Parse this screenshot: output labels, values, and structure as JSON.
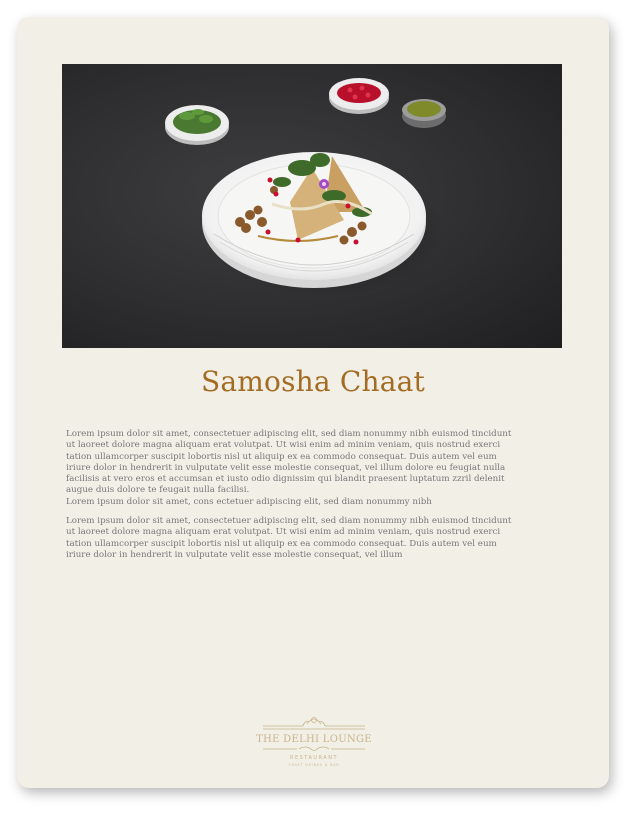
{
  "dish": {
    "title": "Samosha Chaat"
  },
  "description": {
    "paragraph1": [
      "Lorem ipsum dolor sit amet, consectetuer adipiscing elit, sed diam nonummy nibh euismod tincidunt",
      "ut laoreet dolore magna aliquam erat volutpat. Ut wisi enim ad minim veniam, quis nostrud exerci",
      "tation ullamcorper suscipit lobortis nisl ut aliquip ex ea commodo consequat. Duis autem vel eum",
      "iriure dolor in hendrerit in vulputate velit esse molestie consequat, vel illum dolore eu feugiat nulla",
      "facilisis at vero eros et accumsan et iusto odio dignissim qui blandit praesent luptatum zzril delenit",
      "augue duis dolore te feugait nulla facilisi.",
      "Lorem ipsum dolor sit amet, cons ectetuer adipiscing elit, sed diam nonummy nibh"
    ],
    "paragraph2": [
      "Lorem ipsum dolor sit amet, consectetuer adipiscing elit, sed diam nonummy nibh euismod tincidunt",
      "ut laoreet dolore magna aliquam erat volutpat. Ut wisi enim ad minim veniam, quis nostrud exerci",
      "tation ullamcorper suscipit lobortis nisl ut aliquip ex ea commodo consequat. Duis autem vel eum",
      "iriure dolor in hendrerit in vulputate velit esse molestie consequat, vel illum"
    ]
  },
  "brand": {
    "name": "THE DELHI LOUNGE",
    "subtitle": "RESTAURANT",
    "tagline": "CRAFT DRINKS & BAR"
  },
  "colors": {
    "page_bg": "#f2efe7",
    "title": "#a36c22",
    "body_text": "#777777",
    "logo_gold": "#c9b48a"
  }
}
